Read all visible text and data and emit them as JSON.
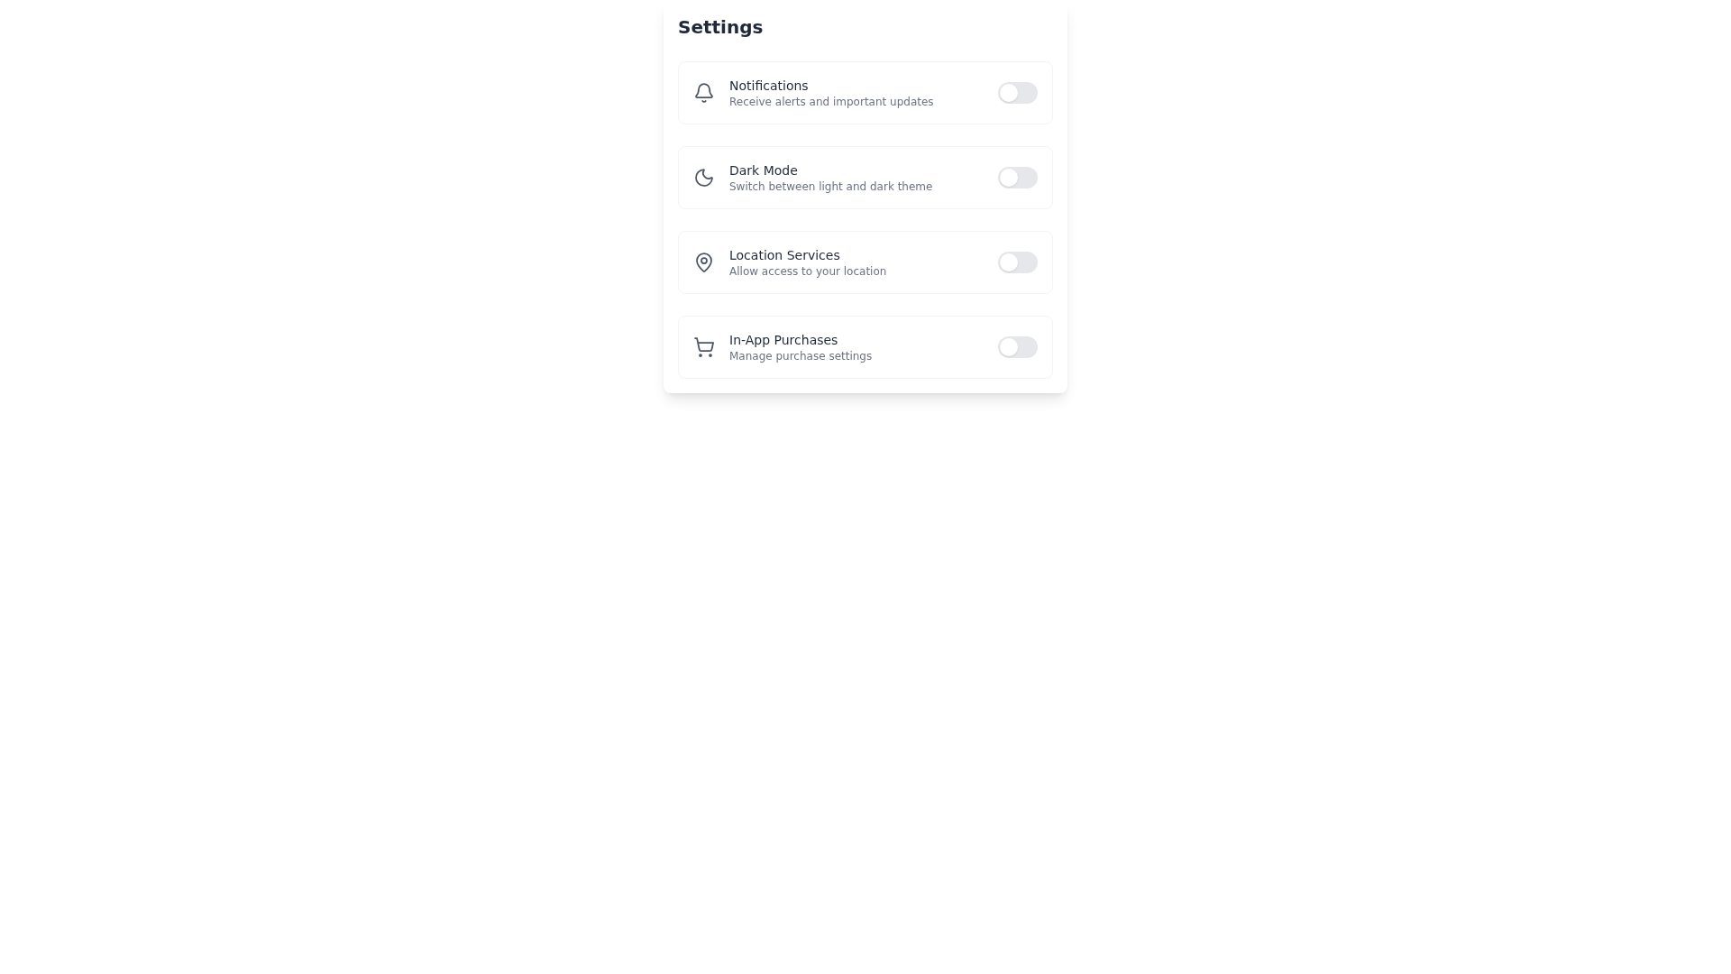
{
  "title": "Settings",
  "settings": [
    {
      "label": "Notifications",
      "description": "Receive alerts and important updates",
      "on": false
    },
    {
      "label": "Dark Mode",
      "description": "Switch between light and dark theme",
      "on": false
    },
    {
      "label": "Location Services",
      "description": "Allow access to your location",
      "on": false
    },
    {
      "label": "In-App Purchases",
      "description": "Manage purchase settings",
      "on": false
    }
  ]
}
